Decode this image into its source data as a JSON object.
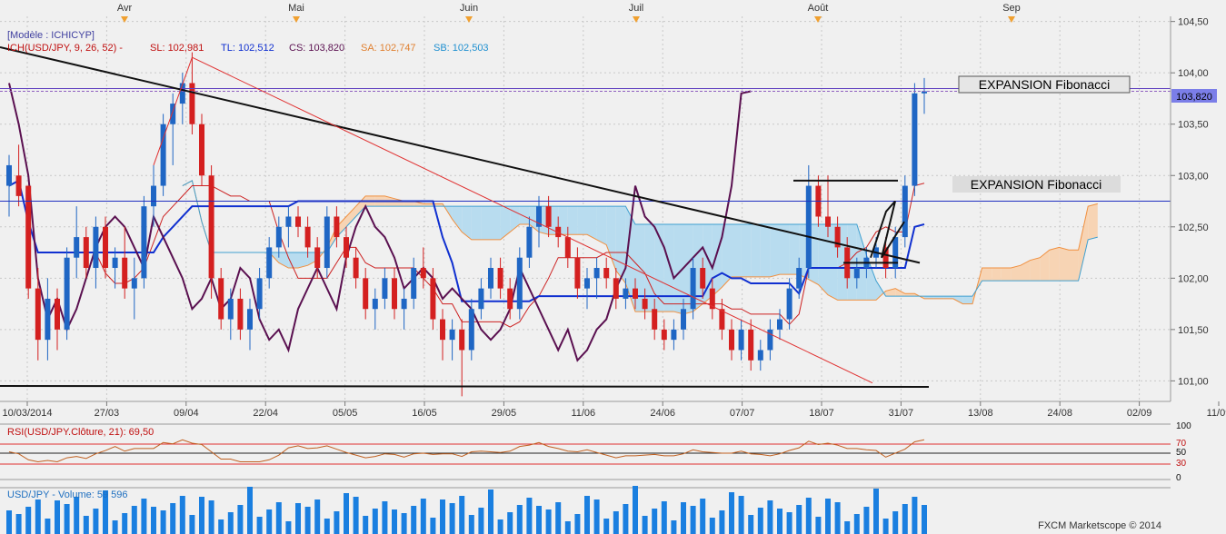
{
  "header": {
    "model": "[Modèle : ICHICYP]",
    "ich_label": "ICH(USD/JPY, 9, 26, 52) -",
    "sl": "SL: 102,981",
    "tl": "TL: 102,512",
    "cs": "CS: 103,820",
    "sa": "SA: 102,747",
    "sb": "SB: 102,503"
  },
  "months": [
    "Avr",
    "Mai",
    "Juin",
    "Juil",
    "Août",
    "Sep"
  ],
  "date_labels": [
    "10/03/2014",
    "27/03",
    "09/04",
    "22/04",
    "05/05",
    "16/05",
    "29/05",
    "11/06",
    "24/06",
    "07/07",
    "18/07",
    "31/07",
    "13/08",
    "24/08",
    "02/09",
    "11/09"
  ],
  "price_labels": [
    "104,50",
    "104,00",
    "103,50",
    "103,00",
    "102,50",
    "102,00",
    "101,50",
    "101,00"
  ],
  "current_price": "103,820",
  "annotations": [
    "EXPANSION Fibonacci",
    "EXPANSION Fibonacci"
  ],
  "rsi": {
    "label": "RSI(USD/JPY.Clôture, 21): 69,50",
    "ticks": [
      "100",
      "70",
      "50",
      "30",
      "0"
    ]
  },
  "volume": {
    "label": "USD/JPY - Volume: 59 596"
  },
  "footer": "FXCM Marketscope © 2014",
  "colors": {
    "bull": "#1f66c4",
    "bear": "#d42020",
    "tenkan": "#cc2020",
    "kijun": "#1030d0",
    "chikou": "#5a1050",
    "senkou_a": "#f09040",
    "senkou_b": "#40a0d0",
    "kumo_bull": "#f7d4b4",
    "kumo_bear": "#b8dcef",
    "grid": "#c8c8c8",
    "volume": "#1a7fe0"
  },
  "chart_data": {
    "type": "candlestick",
    "symbol": "USD/JPY",
    "ylim": [
      100.8,
      104.55
    ],
    "candles_ohlc": [
      [
        102.9,
        103.2,
        102.6,
        103.1
      ],
      [
        103.0,
        103.3,
        102.7,
        102.8
      ],
      [
        102.9,
        102.9,
        101.8,
        101.9
      ],
      [
        101.9,
        102.1,
        101.2,
        101.4
      ],
      [
        101.4,
        102.0,
        101.2,
        101.8
      ],
      [
        101.8,
        101.9,
        101.3,
        101.5
      ],
      [
        101.5,
        102.3,
        101.4,
        102.2
      ],
      [
        102.2,
        102.7,
        102.0,
        102.4
      ],
      [
        102.4,
        102.5,
        102.0,
        102.1
      ],
      [
        102.1,
        102.6,
        101.9,
        102.5
      ],
      [
        102.5,
        102.6,
        102.0,
        102.1
      ],
      [
        102.1,
        102.3,
        101.9,
        102.2
      ],
      [
        102.2,
        102.5,
        101.8,
        101.9
      ],
      [
        101.9,
        102.2,
        101.6,
        102.0
      ],
      [
        102.0,
        102.8,
        101.9,
        102.7
      ],
      [
        102.7,
        103.1,
        102.5,
        102.9
      ],
      [
        102.9,
        103.6,
        102.8,
        103.5
      ],
      [
        103.5,
        103.8,
        103.1,
        103.7
      ],
      [
        103.7,
        104.0,
        103.5,
        103.9
      ],
      [
        103.9,
        104.2,
        103.4,
        103.5
      ],
      [
        103.5,
        103.6,
        102.9,
        103.0
      ],
      [
        103.0,
        103.1,
        101.8,
        102.0
      ],
      [
        102.0,
        102.1,
        101.5,
        101.6
      ],
      [
        101.6,
        101.9,
        101.4,
        101.8
      ],
      [
        101.8,
        101.9,
        101.4,
        101.5
      ],
      [
        101.5,
        101.8,
        101.3,
        101.7
      ],
      [
        101.7,
        102.1,
        101.6,
        102.0
      ],
      [
        102.0,
        102.4,
        101.9,
        102.3
      ],
      [
        102.3,
        102.6,
        102.2,
        102.5
      ],
      [
        102.5,
        102.7,
        102.3,
        102.6
      ],
      [
        102.6,
        102.7,
        102.4,
        102.5
      ],
      [
        102.5,
        102.6,
        102.2,
        102.3
      ],
      [
        102.3,
        102.4,
        102.0,
        102.1
      ],
      [
        102.1,
        102.7,
        102.0,
        102.6
      ],
      [
        102.6,
        102.7,
        102.3,
        102.4
      ],
      [
        102.4,
        102.5,
        102.1,
        102.2
      ],
      [
        102.2,
        102.3,
        101.9,
        102.0
      ],
      [
        102.0,
        102.1,
        101.6,
        101.7
      ],
      [
        101.7,
        101.9,
        101.5,
        101.8
      ],
      [
        101.8,
        102.1,
        101.7,
        102.0
      ],
      [
        102.0,
        102.1,
        101.6,
        101.7
      ],
      [
        101.7,
        101.9,
        101.5,
        101.8
      ],
      [
        101.8,
        102.2,
        101.7,
        102.1
      ],
      [
        102.1,
        102.3,
        101.9,
        102.0
      ],
      [
        102.0,
        102.1,
        101.5,
        101.6
      ],
      [
        101.6,
        101.7,
        101.2,
        101.4
      ],
      [
        101.4,
        101.6,
        101.2,
        101.5
      ],
      [
        101.5,
        101.6,
        100.85,
        101.3
      ],
      [
        101.3,
        101.8,
        101.2,
        101.7
      ],
      [
        101.7,
        102.0,
        101.6,
        101.9
      ],
      [
        101.9,
        102.2,
        101.8,
        102.1
      ],
      [
        102.1,
        102.2,
        101.8,
        101.9
      ],
      [
        101.9,
        102.0,
        101.6,
        101.7
      ],
      [
        101.7,
        102.3,
        101.6,
        102.2
      ],
      [
        102.2,
        102.6,
        102.1,
        102.5
      ],
      [
        102.5,
        102.8,
        102.3,
        102.7
      ],
      [
        102.7,
        102.8,
        102.4,
        102.5
      ],
      [
        102.5,
        102.6,
        102.3,
        102.4
      ],
      [
        102.4,
        102.5,
        102.1,
        102.2
      ],
      [
        102.2,
        102.3,
        101.8,
        101.9
      ],
      [
        101.9,
        102.1,
        101.7,
        102.0
      ],
      [
        102.0,
        102.2,
        101.8,
        102.1
      ],
      [
        102.1,
        102.2,
        101.9,
        102.0
      ],
      [
        102.0,
        102.1,
        101.7,
        101.8
      ],
      [
        101.8,
        102.0,
        101.7,
        101.9
      ],
      [
        101.9,
        102.0,
        101.7,
        101.8
      ],
      [
        101.8,
        101.9,
        101.6,
        101.7
      ],
      [
        101.7,
        101.8,
        101.4,
        101.5
      ],
      [
        101.5,
        101.6,
        101.3,
        101.4
      ],
      [
        101.4,
        101.6,
        101.3,
        101.5
      ],
      [
        101.5,
        101.8,
        101.4,
        101.7
      ],
      [
        101.7,
        102.2,
        101.6,
        102.1
      ],
      [
        102.1,
        102.2,
        101.8,
        101.9
      ],
      [
        101.9,
        102.0,
        101.6,
        101.7
      ],
      [
        101.7,
        101.8,
        101.4,
        101.5
      ],
      [
        101.5,
        101.6,
        101.2,
        101.3
      ],
      [
        101.3,
        101.6,
        101.2,
        101.5
      ],
      [
        101.5,
        101.6,
        101.1,
        101.2
      ],
      [
        101.2,
        101.4,
        101.1,
        101.3
      ],
      [
        101.3,
        101.6,
        101.2,
        101.5
      ],
      [
        101.5,
        101.7,
        101.4,
        101.6
      ],
      [
        101.6,
        102.0,
        101.5,
        101.9
      ],
      [
        101.9,
        102.2,
        101.8,
        102.1
      ],
      [
        102.1,
        103.1,
        102.0,
        102.9
      ],
      [
        102.9,
        103.0,
        102.5,
        102.6
      ],
      [
        102.6,
        103.0,
        102.4,
        102.5
      ],
      [
        102.5,
        102.6,
        102.2,
        102.3
      ],
      [
        102.3,
        102.4,
        101.9,
        102.0
      ],
      [
        102.0,
        102.2,
        101.9,
        102.1
      ],
      [
        102.1,
        102.3,
        102.0,
        102.2
      ],
      [
        102.2,
        102.4,
        102.1,
        102.3
      ],
      [
        102.3,
        102.4,
        102.0,
        102.1
      ],
      [
        102.1,
        102.5,
        102.0,
        102.4
      ],
      [
        102.4,
        103.0,
        102.3,
        102.9
      ],
      [
        102.9,
        103.9,
        102.8,
        103.8
      ],
      [
        103.8,
        103.95,
        103.6,
        103.82
      ]
    ],
    "levels": [
      {
        "name": "price_line",
        "value": 103.82
      },
      {
        "name": "fibonacci_expansion_1",
        "value": 103.82
      },
      {
        "name": "fibonacci_expansion_2",
        "value": 102.75
      },
      {
        "name": "support",
        "value": 100.95
      }
    ]
  }
}
